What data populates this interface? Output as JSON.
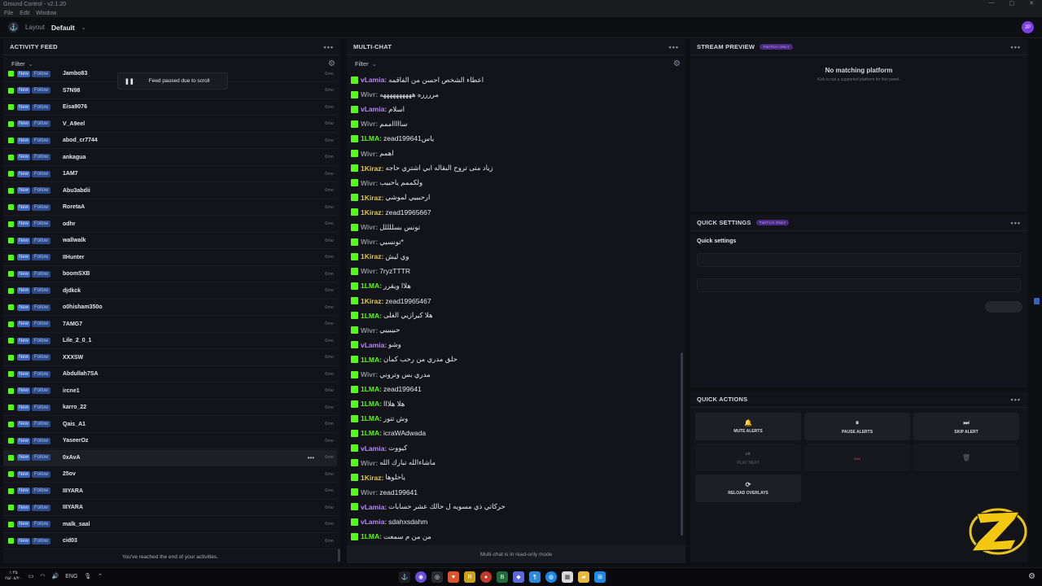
{
  "window": {
    "title": "Ground Control - v2.1.20",
    "controls": [
      "—",
      "▢",
      "✕"
    ]
  },
  "menu": [
    "File",
    "Edit",
    "Window"
  ],
  "appbar": {
    "layout_label": "Layout",
    "layout_value": "Default",
    "avatar": "2P"
  },
  "feed": {
    "title": "ACTIVITY FEED",
    "filter": "Filter",
    "paused_text": "Feed paused due to scroll",
    "end_text": "You've reached the end of your activities.",
    "tag_new": "New",
    "tag_follow": "Follow",
    "time": "6mo",
    "rows": [
      "Jambo83",
      "S7N98",
      "Eisa9076",
      "V_A9eel",
      "abod_cr7744",
      "ankagua",
      "1AM7",
      "Abu3abdii",
      "RoretaA",
      "odhr",
      "wallwalk",
      "IIHunter",
      "boomSXB",
      "djdkck",
      "o0hisham350o",
      "7AMG7",
      "Lile_2_0_1",
      "XXXSW",
      "Abdullah7SA",
      "ircne1",
      "karro_22",
      "Qais_A1",
      "YaseerOz",
      "0xAvA",
      "25ov",
      "IIIYARA",
      "IIIYARA",
      "malk_saal",
      "cid03"
    ],
    "highlight_index": 23
  },
  "chat": {
    "title": "MULTI-CHAT",
    "filter": "Filter",
    "footer": "Multi-chat is in read-only mode",
    "colors": {
      "vLamia": "#b48cf0",
      "Wivr": "#8a8c93",
      "1LMA": "#53fc18",
      "1Kiraz": "#e6c94a"
    },
    "lines": [
      {
        "user": "vLamia",
        "msg": "اعطاء الشخص احسن من الفاقمه"
      },
      {
        "user": "Wivr",
        "msg": "مرررره ههههههههههه"
      },
      {
        "user": "vLamia",
        "msg": "اسلام"
      },
      {
        "user": "Wivr",
        "msg": "ساااااممم"
      },
      {
        "user": "1LMA",
        "msg": "ياسzead199641"
      },
      {
        "user": "Wivr",
        "msg": "اهمم"
      },
      {
        "user": "1Kiraz",
        "msg": "زياد متى تروح البقاله ابي اشتري حاجه"
      },
      {
        "user": "Wivr",
        "msg": "ولكممم ياحبيب"
      },
      {
        "user": "1Kiraz",
        "msg": "ارحبييي لموشي"
      },
      {
        "user": "1Kiraz",
        "msg": "zead19965667"
      },
      {
        "user": "Wivr",
        "msg": "تونس بسللللل"
      },
      {
        "user": "Wivr",
        "msg": "*تونسيي"
      },
      {
        "user": "1Kiraz",
        "msg": "وي ليش"
      },
      {
        "user": "Wivr",
        "msg": "7ryzTTTR"
      },
      {
        "user": "1LMA",
        "msg": "هلاا ويقرر"
      },
      {
        "user": "1Kiraz",
        "msg": "zead19965467"
      },
      {
        "user": "1LMA",
        "msg": "هلا كيرازيي الغلى"
      },
      {
        "user": "Wivr",
        "msg": "حبيبييي"
      },
      {
        "user": "vLamia",
        "msg": "وشو"
      },
      {
        "user": "1LMA",
        "msg": "حلق مدري من رحب كمان"
      },
      {
        "user": "Wivr",
        "msg": "مدري بس وتروني"
      },
      {
        "user": "1LMA",
        "msg": "zead199641"
      },
      {
        "user": "1LMA",
        "msg": "هلا هلااا"
      },
      {
        "user": "1LMA",
        "msg": "وش تتور"
      },
      {
        "user": "1LMA",
        "msg": "icraWAdwada"
      },
      {
        "user": "vLamia",
        "msg": "كيووت"
      },
      {
        "user": "Wivr",
        "msg": "ماشاءالله تبارك الله"
      },
      {
        "user": "1Kiraz",
        "msg": "ياحلوها"
      },
      {
        "user": "Wivr",
        "msg": "zead199641"
      },
      {
        "user": "vLamia",
        "msg": "حركاتي ذي مسويه ل حالك عشر حسابات"
      },
      {
        "user": "vLamia",
        "msg": "sdahxsdahm"
      },
      {
        "user": "1LMA",
        "msg": "من من م سمعت"
      }
    ]
  },
  "preview": {
    "title": "STREAM PREVIEW",
    "badge": "TWITCH ONLY",
    "empty_title": "No matching platform",
    "empty_sub": "Kick is not a supported platform for this panel."
  },
  "quick_settings": {
    "title": "QUICK SETTINGS",
    "badge": "TWITCH ONLY",
    "heading": "Quick settings"
  },
  "quick_actions": {
    "title": "QUICK ACTIONS",
    "buttons": [
      {
        "label": "MUTE ALERTS",
        "icon": "🔔"
      },
      {
        "label": "PAUSE ALERTS",
        "icon": "⏸"
      },
      {
        "label": "SKIP ALERT",
        "icon": "⏭"
      },
      {
        "label": "PLAY NEXT",
        "icon": "⏯"
      },
      {
        "label": "",
        "icon": ""
      },
      {
        "label": "",
        "icon": ""
      },
      {
        "label": "RELOAD OVERLAYS",
        "icon": "⟳"
      }
    ]
  },
  "taskbar": {
    "time": "۱:۳۵",
    "date": "۲۵/۰۸/۲۰",
    "lang": "ENG"
  }
}
